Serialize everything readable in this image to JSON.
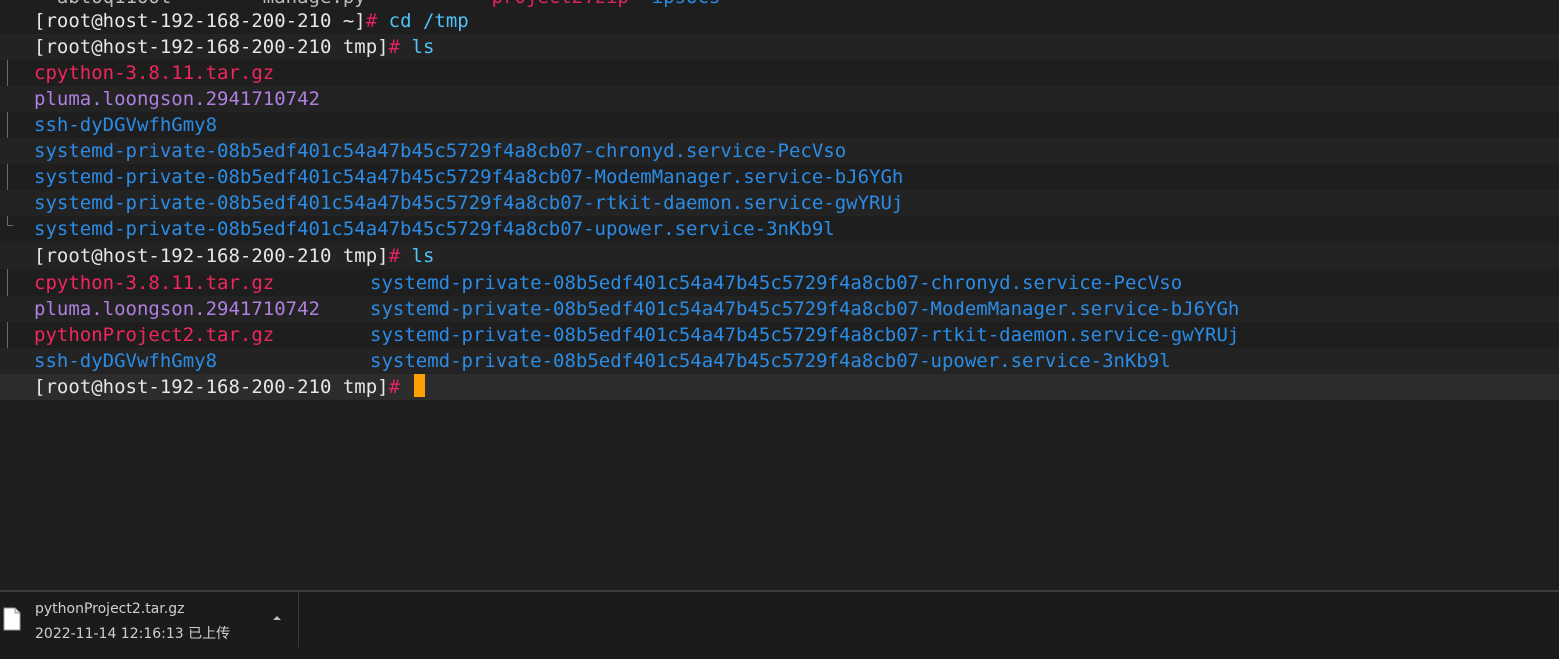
{
  "terminal": {
    "prompt": "[root@host-192-168-200-210 ~]",
    "prompt_tmp": "[root@host-192-168-200-210 tmp]",
    "hash": "#",
    "cmd_cd": " cd /tmp",
    "cmd_ls": " ls",
    "listing1": [
      {
        "name": "cpython-3.8.11.tar.gz",
        "kind": "archive"
      },
      {
        "name": "pluma.loongson.2941710742",
        "kind": "file-purple"
      },
      {
        "name": "ssh-dyDGVwfhGmy8",
        "kind": "dir"
      },
      {
        "name": "systemd-private-08b5edf401c54a47b45c5729f4a8cb07-chronyd.service-PecVso",
        "kind": "dir"
      },
      {
        "name": "systemd-private-08b5edf401c54a47b45c5729f4a8cb07-ModemManager.service-bJ6YGh",
        "kind": "dir"
      },
      {
        "name": "systemd-private-08b5edf401c54a47b45c5729f4a8cb07-rtkit-daemon.service-gwYRUj",
        "kind": "dir"
      },
      {
        "name": "systemd-private-08b5edf401c54a47b45c5729f4a8cb07-upower.service-3nKb9l",
        "kind": "dir"
      }
    ],
    "listing2_col1": [
      {
        "name": "cpython-3.8.11.tar.gz",
        "kind": "archive"
      },
      {
        "name": "pluma.loongson.2941710742",
        "kind": "file-purple"
      },
      {
        "name": "pythonProject2.tar.gz",
        "kind": "archive"
      },
      {
        "name": "ssh-dyDGVwfhGmy8",
        "kind": "dir"
      }
    ],
    "listing2_col2": [
      {
        "name": "systemd-private-08b5edf401c54a47b45c5729f4a8cb07-chronyd.service-PecVso",
        "kind": "dir"
      },
      {
        "name": "systemd-private-08b5edf401c54a47b45c5729f4a8cb07-ModemManager.service-bJ6YGh",
        "kind": "dir"
      },
      {
        "name": "systemd-private-08b5edf401c54a47b45c5729f4a8cb07-rtkit-daemon.service-gwYRUj",
        "kind": "dir"
      },
      {
        "name": "systemd-private-08b5edf401c54a47b45c5729f4a8cb07-upower.service-3nKb9l",
        "kind": "dir"
      }
    ]
  },
  "download": {
    "file_name": "pythonProject2.tar.gz",
    "status": "2022-11-14 12:16:13 已上传",
    "icon": "file-icon",
    "caret_icon": "chevron-up-icon"
  },
  "colors": {
    "archive": "#f0265d",
    "dir": "#2b8ce6",
    "file_purple": "#b07fe0",
    "command": "#4fc3f7",
    "cursor": "#ffa000"
  }
}
